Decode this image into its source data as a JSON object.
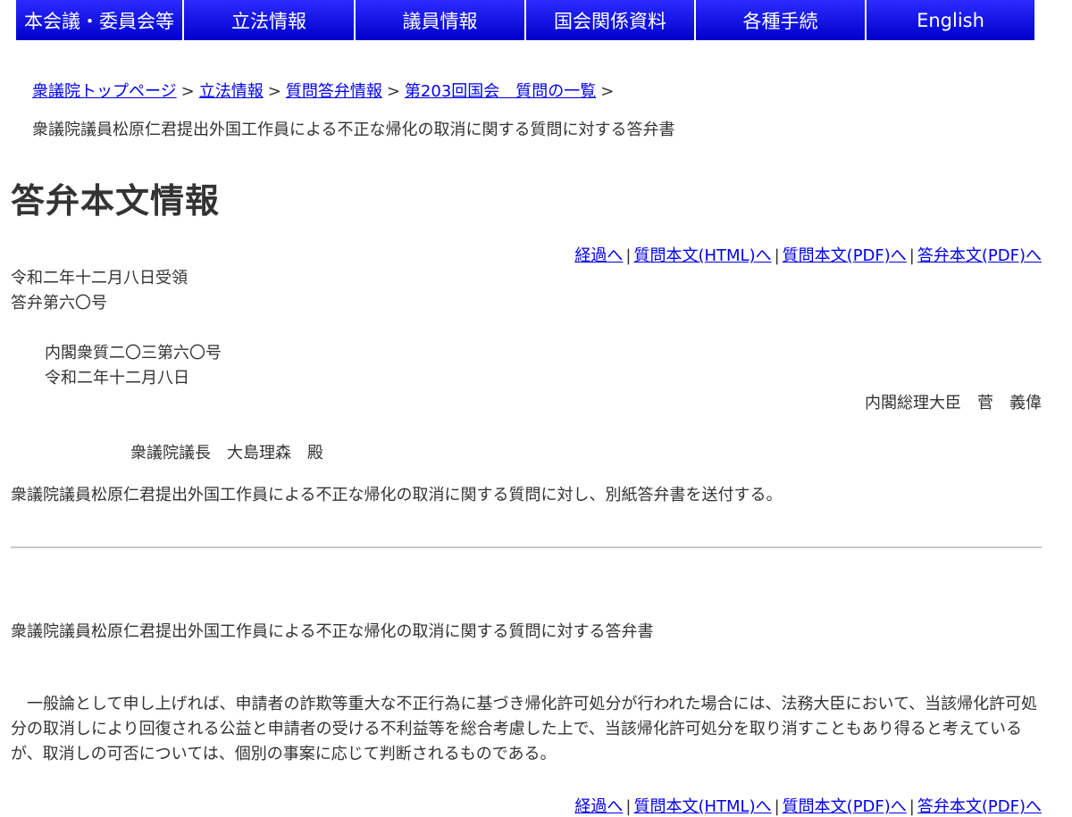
{
  "nav": [
    {
      "label": "本会議・委員会等"
    },
    {
      "label": "立法情報"
    },
    {
      "label": "議員情報"
    },
    {
      "label": "国会関係資料"
    },
    {
      "label": "各種手続"
    },
    {
      "label": "English"
    }
  ],
  "breadcrumb": {
    "items": [
      "衆議院トップページ",
      "立法情報",
      "質問答弁情報",
      "第203回国会　質問の一覧"
    ],
    "separator": ">",
    "current": "衆議院議員松原仁君提出外国工作員による不正な帰化の取消に関する質問に対する答弁書"
  },
  "page_title": "答弁本文情報",
  "doc_links": {
    "keika": "経過へ",
    "question_html": "質問本文(HTML)へ",
    "question_pdf": "質問本文(PDF)へ",
    "answer_pdf": "答弁本文(PDF)へ",
    "divider": "|"
  },
  "document": {
    "received": "令和二年十二月八日受領",
    "answer_no": "答弁第六〇号",
    "cabinet_no": "内閣衆質二〇三第六〇号",
    "date": "令和二年十二月八日",
    "sender": "内閣総理大臣　菅　義偉",
    "recipient": "衆議院議長　大島理森　殿",
    "cover_text": "衆議院議員松原仁君提出外国工作員による不正な帰化の取消に関する質問に対し、別紙答弁書を送付する。",
    "answer_title": "衆議院議員松原仁君提出外国工作員による不正な帰化の取消に関する質問に対する答弁書",
    "answer_body": "一般論として申し上げれば、申請者の詐欺等重大な不正行為に基づき帰化許可処分が行われた場合には、法務大臣において、当該帰化許可処分の取消しにより回復される公益と申請者の受ける不利益等を総合考慮した上で、当該帰化許可処分を取り消すこともあり得ると考えているが、取消しの可否については、個別の事案に応じて判断されるものである。"
  },
  "colors": {
    "nav_bg": "#0000cc",
    "link": "#0000ee",
    "text": "#333333",
    "divider": "#c8c8c8"
  }
}
